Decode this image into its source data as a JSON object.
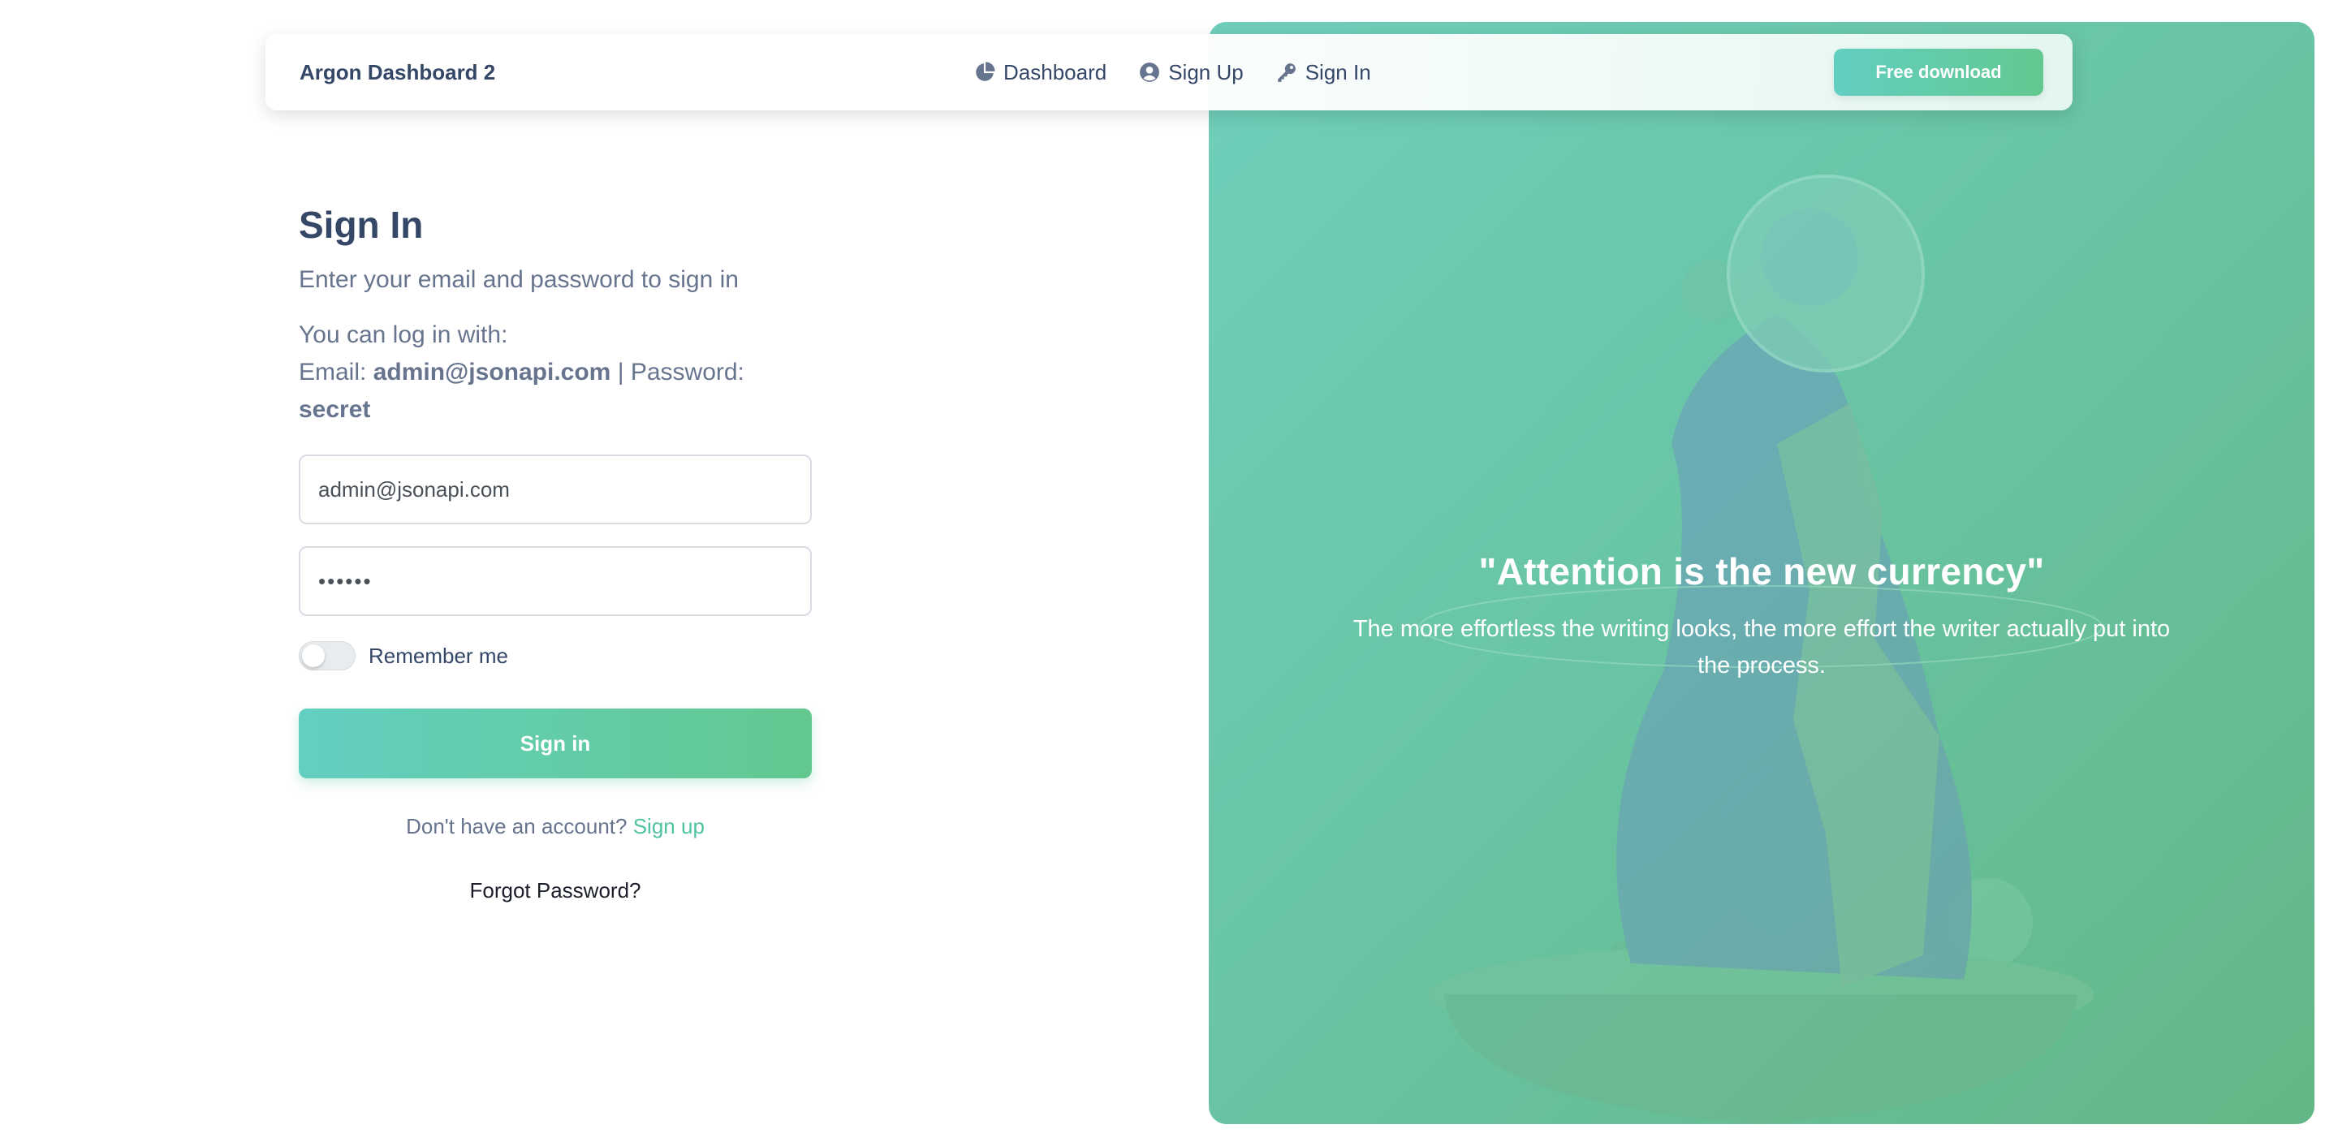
{
  "navbar": {
    "brand": "Argon Dashboard 2",
    "links": [
      {
        "label": "Dashboard",
        "icon": "pie-chart-icon"
      },
      {
        "label": "Sign Up",
        "icon": "user-circle-icon"
      },
      {
        "label": "Sign In",
        "icon": "key-icon"
      }
    ],
    "download_label": "Free download"
  },
  "form": {
    "title": "Sign In",
    "subtitle": "Enter your email and password to sign in",
    "hint_line1": "You can log in with:",
    "hint_email_label": "Email:",
    "hint_email": "admin@jsonapi.com",
    "hint_sep": "|",
    "hint_password_label": "Password:",
    "hint_password": "secret",
    "email_value": "admin@jsonapi.com",
    "password_value": "••••••",
    "remember_label": "Remember me",
    "remember_checked": false,
    "submit_label": "Sign in",
    "no_account_text": "Don't have an account?",
    "signup_link": "Sign up",
    "forgot_label": "Forgot Password?"
  },
  "hero": {
    "quote": "\"Attention is the new currency\"",
    "text": "The more effortless the writing looks, the more effort the writer actually put into the process."
  },
  "colors": {
    "primary_start": "#63cfc1",
    "primary_end": "#63c88f",
    "text_dark": "#344767",
    "text_muted": "#67748e",
    "link": "#4fc3a1"
  }
}
